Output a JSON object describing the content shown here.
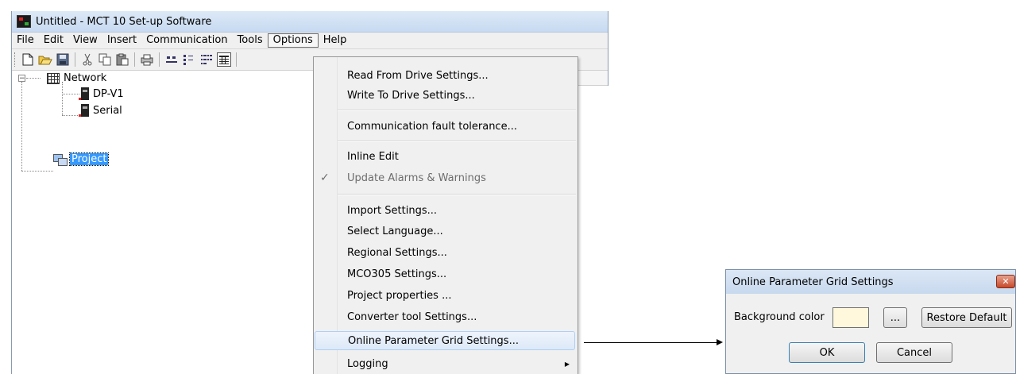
{
  "window": {
    "title": "Untitled - MCT 10 Set-up Software"
  },
  "menubar": {
    "items": [
      "File",
      "Edit",
      "View",
      "Insert",
      "Communication",
      "Tools",
      "Options",
      "Help"
    ],
    "active": "Options"
  },
  "toolbar": {
    "icons": [
      "new-icon",
      "open-icon",
      "save-icon",
      "cut-icon",
      "copy-icon",
      "paste-icon",
      "print-icon",
      "large-icons-icon",
      "small-icons-icon",
      "list-icon",
      "details-icon"
    ]
  },
  "tree": {
    "network": "Network",
    "dpv1": "DP-V1",
    "serial": "Serial",
    "project": "Project"
  },
  "options_menu": {
    "items": [
      {
        "label": "Read From Drive Settings..."
      },
      {
        "label": "Write To Drive Settings..."
      },
      {
        "label": "Communication fault tolerance..."
      },
      {
        "label": "Inline Edit"
      },
      {
        "label": "Update Alarms & Warnings",
        "checked": true,
        "disabled": true
      },
      {
        "label": "Import Settings..."
      },
      {
        "label": "Select Language..."
      },
      {
        "label": "Regional Settings..."
      },
      {
        "label": "MCO305 Settings..."
      },
      {
        "label": "Project properties ..."
      },
      {
        "label": "Converter tool Settings..."
      },
      {
        "label": "Online Parameter Grid Settings...",
        "highlighted": true
      },
      {
        "label": "Logging",
        "submenu": true
      }
    ],
    "check_mark": "✓",
    "submenu_arrow": "▶"
  },
  "dialog": {
    "title": "Online Parameter Grid Settings",
    "close": "✕",
    "background_color_label": "Background color",
    "background_color": "#fff8dc",
    "browse_label": "...",
    "restore_default_label": "Restore Default",
    "ok_label": "OK",
    "cancel_label": "Cancel"
  }
}
